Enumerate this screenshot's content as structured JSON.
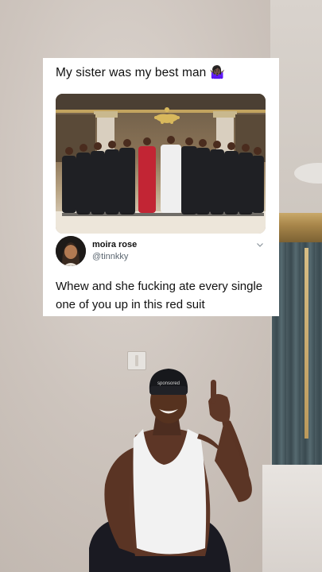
{
  "tweet": {
    "caption": "My sister was my best man 🤷🏿‍♀️",
    "author_name": "moira rose",
    "author_handle": "@tinnkky",
    "body": "Whew and she fucking ate every single one of you up in this red suit"
  },
  "beanie_text": "sponsored",
  "colors": {
    "card_bg": "#ffffff",
    "handle": "#5b6670",
    "red_suit": "#c22534",
    "white_suit": "#efefef"
  }
}
